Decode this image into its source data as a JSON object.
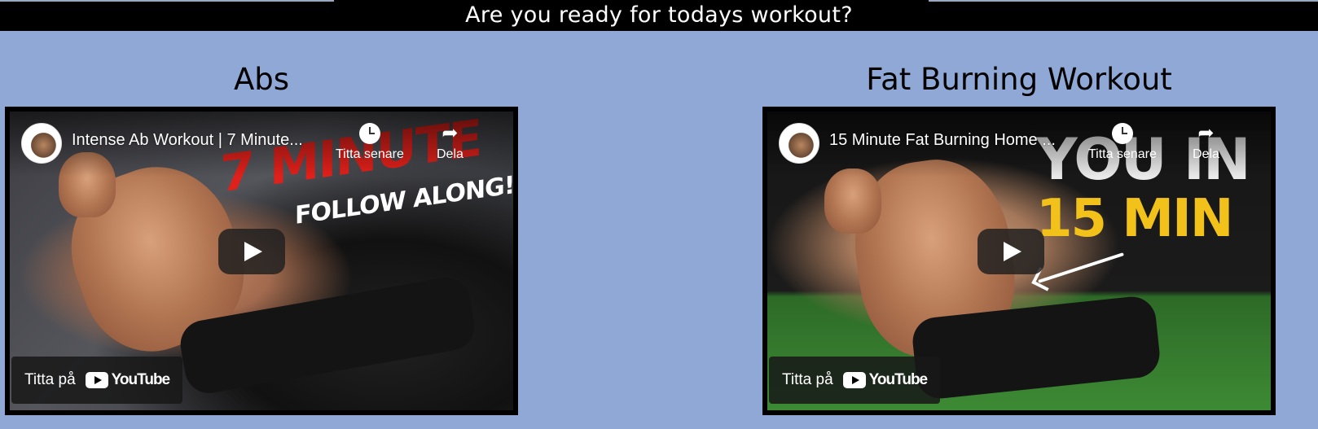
{
  "header": {
    "title": "Are you ready for todays workout?"
  },
  "sections": [
    {
      "heading": "Abs",
      "video": {
        "title": "Intense Ab Workout | 7 Minute...",
        "watch_later": "Titta senare",
        "share": "Dela",
        "watch_on": "Titta på",
        "platform": "YouTube",
        "thumbnail_text": [
          "7 MINUTE",
          "FOLLOW ALONG!"
        ]
      }
    },
    {
      "heading": "Fat Burning Workout",
      "video": {
        "title": "15 Minute Fat Burning Home ...",
        "watch_later": "Titta senare",
        "share": "Dela",
        "watch_on": "Titta på",
        "platform": "YouTube",
        "thumbnail_text": [
          "YOU IN",
          "15 MIN"
        ]
      }
    }
  ],
  "colors": {
    "page_background": "#8fa8d6",
    "header_background": "#000000",
    "youtube_red": "#e0201a",
    "highlight_yellow": "#f3c21a"
  },
  "icons": [
    "clock-icon",
    "share-icon",
    "play-icon",
    "youtube-logo-icon",
    "channel-avatar"
  ]
}
